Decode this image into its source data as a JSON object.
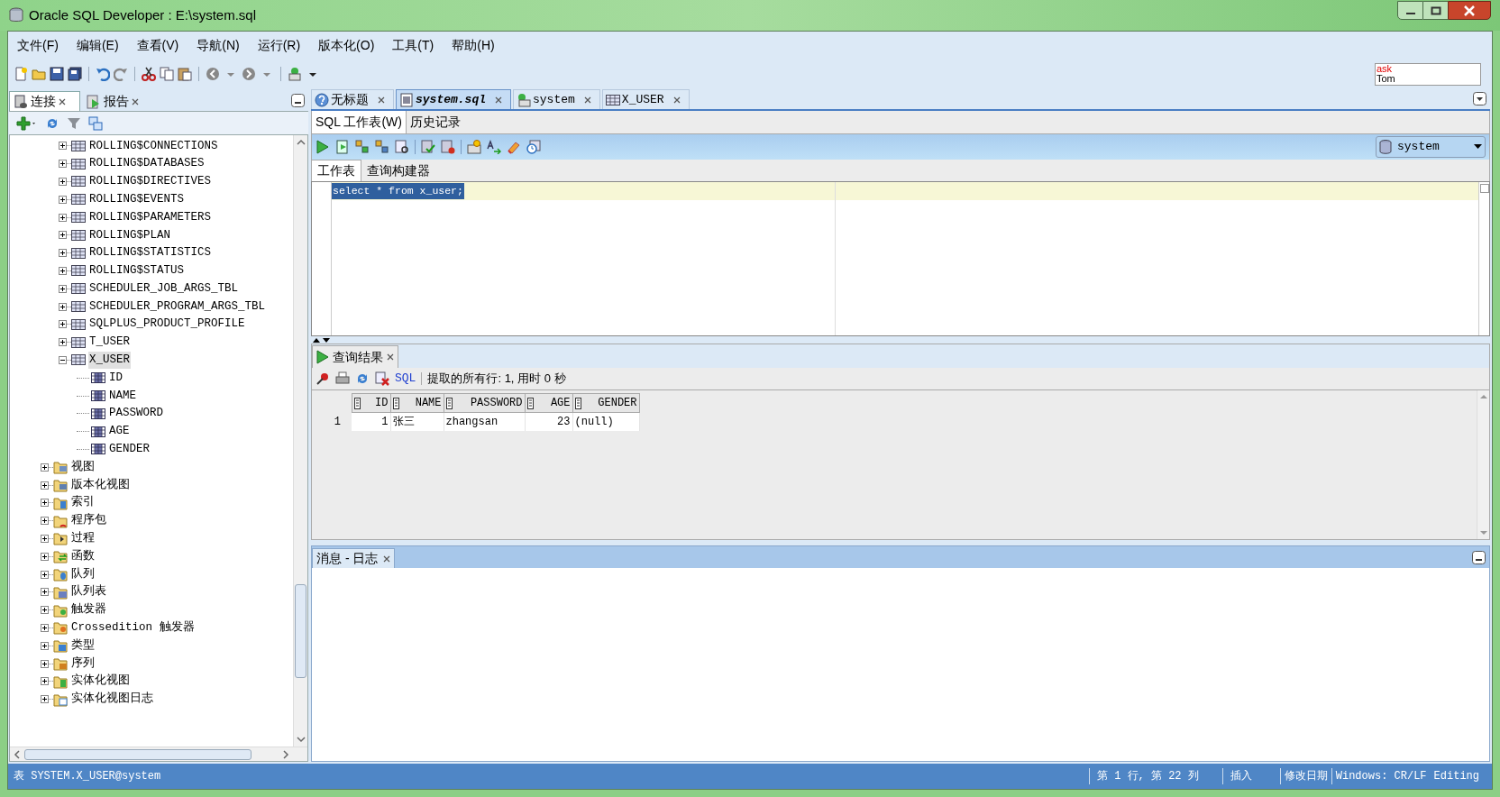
{
  "window": {
    "title": "Oracle SQL Developer : E:\\system.sql"
  },
  "menu": [
    "文件(F)",
    "编辑(E)",
    "查看(V)",
    "导航(N)",
    "运行(R)",
    "版本化(O)",
    "工具(T)",
    "帮助(H)"
  ],
  "ask_tom": {
    "line_1": "ask",
    "line_2": "Tom"
  },
  "left_panel": {
    "tabs": [
      {
        "label": "连接",
        "selected": true
      },
      {
        "label": "报告",
        "selected": false
      }
    ],
    "tree": [
      {
        "children": [
          {
            "label": "ROLLING$CONNECTIONS",
            "kind": "table",
            "expanded": false,
            "selected": false
          },
          {
            "label": "ROLLING$DATABASES",
            "kind": "table",
            "expanded": false,
            "selected": false
          },
          {
            "label": "ROLLING$DIRECTIVES",
            "kind": "table",
            "expanded": false,
            "selected": false
          },
          {
            "label": "ROLLING$EVENTS",
            "kind": "table",
            "expanded": false,
            "selected": false
          },
          {
            "label": "ROLLING$PARAMETERS",
            "kind": "table",
            "expanded": false,
            "selected": false
          },
          {
            "label": "ROLLING$PLAN",
            "kind": "table",
            "expanded": false,
            "selected": false
          },
          {
            "label": "ROLLING$STATISTICS",
            "kind": "table",
            "expanded": false,
            "selected": false
          },
          {
            "label": "ROLLING$STATUS",
            "kind": "table",
            "expanded": false,
            "selected": false
          },
          {
            "label": "SCHEDULER_JOB_ARGS_TBL",
            "kind": "table",
            "expanded": false,
            "selected": false
          },
          {
            "label": "SCHEDULER_PROGRAM_ARGS_TBL",
            "kind": "table",
            "expanded": false,
            "selected": false
          },
          {
            "label": "SQLPLUS_PRODUCT_PROFILE",
            "kind": "table",
            "expanded": false,
            "selected": false
          },
          {
            "label": "T_USER",
            "kind": "table",
            "expanded": false,
            "selected": false
          },
          {
            "label": "X_USER",
            "kind": "table",
            "expanded": true,
            "selected": true,
            "children": [
              {
                "label": "ID",
                "kind": "column"
              },
              {
                "label": "NAME",
                "kind": "column"
              },
              {
                "label": "PASSWORD",
                "kind": "column"
              },
              {
                "label": "AGE",
                "kind": "column"
              },
              {
                "label": "GENDER",
                "kind": "column"
              }
            ]
          }
        ]
      },
      {
        "label": "视图",
        "kind": "folder",
        "expanded": false
      },
      {
        "label": "版本化视图",
        "kind": "folder",
        "expanded": false
      },
      {
        "label": "索引",
        "kind": "folder",
        "expanded": false
      },
      {
        "label": "程序包",
        "kind": "folder",
        "expanded": false
      },
      {
        "label": "过程",
        "kind": "folder",
        "expanded": false
      },
      {
        "label": "函数",
        "kind": "folder",
        "expanded": false
      },
      {
        "label": "队列",
        "kind": "folder",
        "expanded": false
      },
      {
        "label": "队列表",
        "kind": "folder",
        "expanded": false
      },
      {
        "label": "触发器",
        "kind": "folder",
        "expanded": false
      },
      {
        "label": "Crossedition 触发器",
        "kind": "folder",
        "expanded": false
      },
      {
        "label": "类型",
        "kind": "folder",
        "expanded": false
      },
      {
        "label": "序列",
        "kind": "folder",
        "expanded": false
      },
      {
        "label": "实体化视图",
        "kind": "folder",
        "expanded": false
      },
      {
        "label": "实体化视图日志",
        "kind": "folder",
        "expanded": false
      }
    ]
  },
  "editor": {
    "doc_tabs": [
      {
        "label": "无标题",
        "kind": "help",
        "selected": false
      },
      {
        "label": "system.sql",
        "kind": "file",
        "selected": true
      },
      {
        "label": "system",
        "kind": "connection",
        "selected": false
      },
      {
        "label": "X_USER",
        "kind": "table",
        "selected": false
      }
    ],
    "sub_tabs": [
      {
        "label": "SQL 工作表(W)",
        "selected": true
      },
      {
        "label": "历史记录",
        "selected": false
      }
    ],
    "connection": "system",
    "worksheet_tabs": [
      {
        "label": "工作表",
        "selected": true
      },
      {
        "label": "查询构建器",
        "selected": false
      }
    ],
    "code": "select * from x_user;",
    "code_selected": true
  },
  "results": {
    "tab": "查询结果",
    "sql_link": "SQL",
    "summary": "提取的所有行: 1, 用时 0 秒",
    "columns": [
      "ID",
      "NAME",
      "PASSWORD",
      "AGE",
      "GENDER"
    ],
    "rows": [
      {
        "number": "1",
        "cells": [
          "1",
          "张三",
          "zhangsan",
          "23",
          "(null)"
        ]
      }
    ]
  },
  "messages": {
    "tab": "消息 - 日志"
  },
  "status_bar": {
    "left": "表 SYSTEM.X_USER@system",
    "position": "第 1 行, 第 22 列",
    "mode": "插入",
    "modified": "修改日期",
    "line_endings": "Windows: CR/LF",
    "state": "Editing"
  }
}
